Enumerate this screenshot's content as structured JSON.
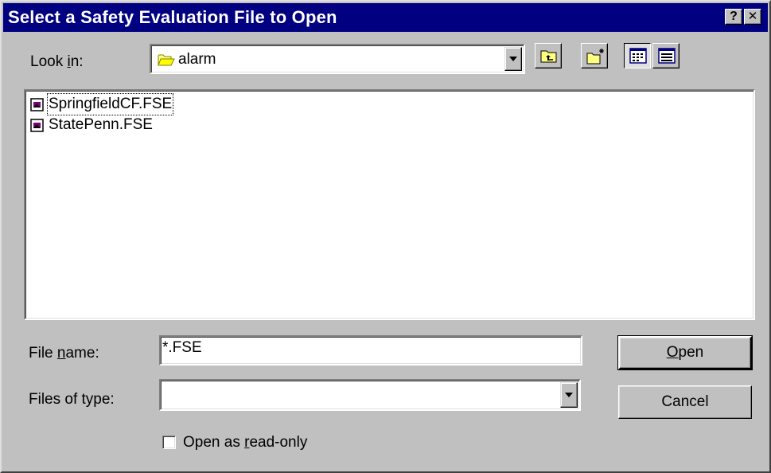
{
  "window": {
    "title": "Select a Safety Evaluation File to Open",
    "help_label": "?",
    "close_label": "✕"
  },
  "look_in": {
    "label_pre": "Look ",
    "label_key": "i",
    "label_post": "n:",
    "value": "alarm",
    "icon": "folder-icon"
  },
  "toolbar": {
    "buttons": [
      {
        "name": "up-one-level",
        "icon": "up-folder-icon"
      },
      {
        "name": "create-new-folder",
        "icon": "new-folder-icon"
      },
      {
        "name": "list-view",
        "icon": "list-view-icon",
        "pressed": true
      },
      {
        "name": "details-view",
        "icon": "details-view-icon",
        "pressed": false
      }
    ]
  },
  "files": {
    "items": [
      {
        "name": "SpringfieldCF.FSE",
        "icon": "fse-file-icon",
        "focused": true
      },
      {
        "name": "StatePenn.FSE",
        "icon": "fse-file-icon",
        "focused": false
      }
    ]
  },
  "file_name": {
    "label_pre": "File ",
    "label_key": "n",
    "label_post": "ame:",
    "value": "*.FSE"
  },
  "file_type": {
    "label": "Files of type:",
    "value": ""
  },
  "read_only": {
    "label_pre": "Open as ",
    "label_key": "r",
    "label_post": "ead-only",
    "checked": false
  },
  "buttons": {
    "open_key": "O",
    "open_rest": "pen",
    "cancel": "Cancel"
  },
  "colors": {
    "titlebar": "#000080",
    "face": "#c0c0c0",
    "window": "#ffffff"
  }
}
